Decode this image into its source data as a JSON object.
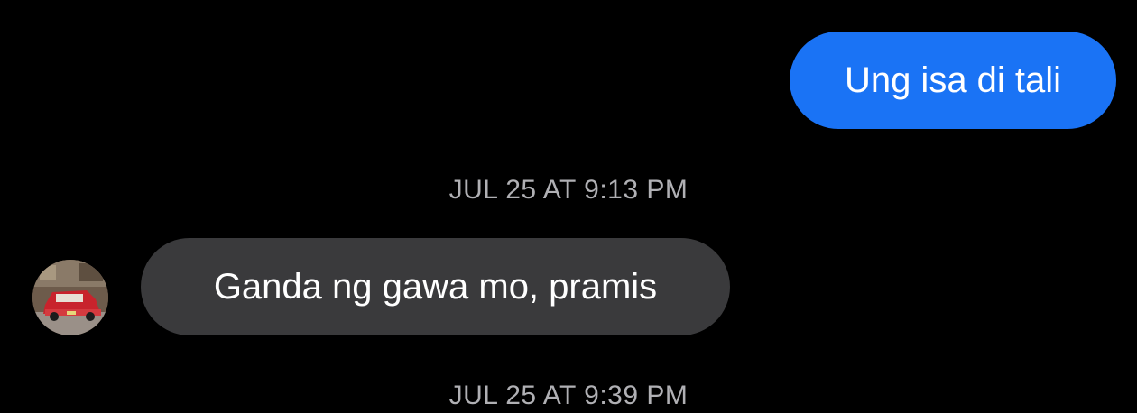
{
  "conversation": {
    "messages": [
      {
        "direction": "outgoing",
        "text": "Ung isa di tali"
      },
      {
        "direction": "timestamp",
        "text": "JUL 25 AT 9:13 PM"
      },
      {
        "direction": "incoming",
        "text": "Ganda ng gawa mo, pramis"
      },
      {
        "direction": "timestamp",
        "text": "JUL 25 AT 9:39 PM"
      }
    ]
  },
  "contact": {
    "avatar_icon": "contact-photo-red-taxi"
  },
  "colors": {
    "background": "#000000",
    "outgoing_bubble": "#1a73f5",
    "incoming_bubble": "#3a3a3c",
    "message_text": "#ffffff",
    "timestamp_text": "#b0b0b4"
  }
}
